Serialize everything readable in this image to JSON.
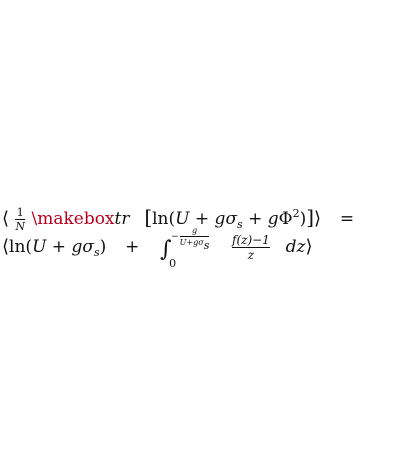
{
  "equation": {
    "line1": {
      "langle": "⟨",
      "frac_num": "1",
      "frac_den": "N",
      "error_cmd": "\\makebox",
      "tr": "tr",
      "lbracket": "[",
      "ln_open": "ln(",
      "U": "U",
      "plus1": "+",
      "g1": "g",
      "sigma": "σ",
      "sub_s": "s",
      "plus2": "+",
      "g2": "g",
      "Phi": "Φ",
      "sup_2": "2",
      "close_paren": ")",
      "rbracket": "]",
      "rangle": "⟩",
      "equals": "="
    },
    "line2": {
      "langle": "⟨",
      "ln_open": "ln(",
      "U": "U",
      "plus": "+",
      "g": "g",
      "sigma": "σ",
      "sub_s": "s",
      "close_paren": ")",
      "plus2": "+",
      "integral": "∫",
      "lower_limit": "0",
      "upper_minus": "−",
      "upper_num": "g",
      "upper_den": "U+gσ",
      "upper_den_sub": "s",
      "frac_num": "f(z)−1",
      "frac_den": "z",
      "dz": "dz",
      "rangle": "⟩"
    }
  }
}
